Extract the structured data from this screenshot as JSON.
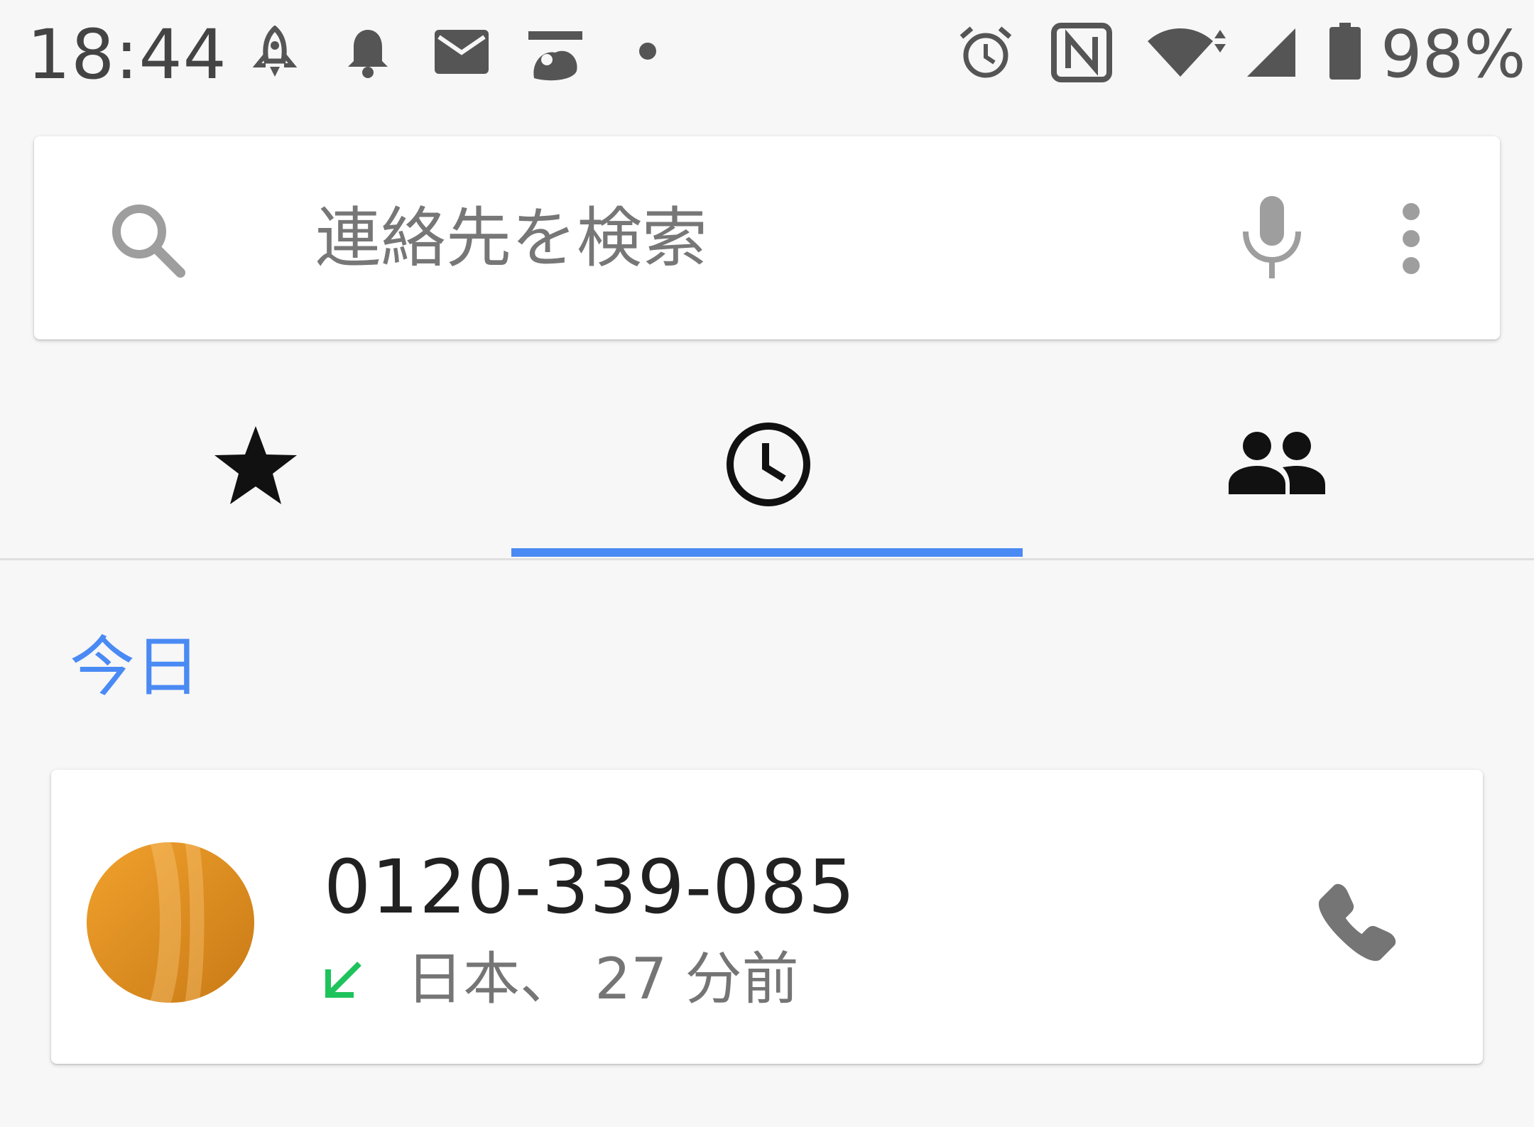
{
  "status_bar": {
    "time": "18:44",
    "battery_percent": "98%",
    "icons": [
      "rocket-icon",
      "bell-icon",
      "mail-icon",
      "jmty-app-icon",
      "dot-icon",
      "alarm-icon",
      "nfc-icon",
      "wifi-icon",
      "signal-icon",
      "battery-icon"
    ]
  },
  "search": {
    "placeholder": "連絡先を検索",
    "icons": [
      "search-icon",
      "mic-icon",
      "more-vert-icon"
    ]
  },
  "tabs": [
    {
      "name": "favorites",
      "icon": "star-icon",
      "selected": false
    },
    {
      "name": "recents",
      "icon": "clock-icon",
      "selected": true
    },
    {
      "name": "contacts",
      "icon": "people-icon",
      "selected": false
    }
  ],
  "section": {
    "title": "今日"
  },
  "calls": [
    {
      "number": "0120-339-085",
      "meta": "日本、 27 分前",
      "type_icon": "incoming-call-icon",
      "action_icon": "phone-icon"
    }
  ],
  "colors": {
    "accent": "#4a8af4",
    "incoming": "#1ec35c",
    "avatar": "#e0901e"
  }
}
